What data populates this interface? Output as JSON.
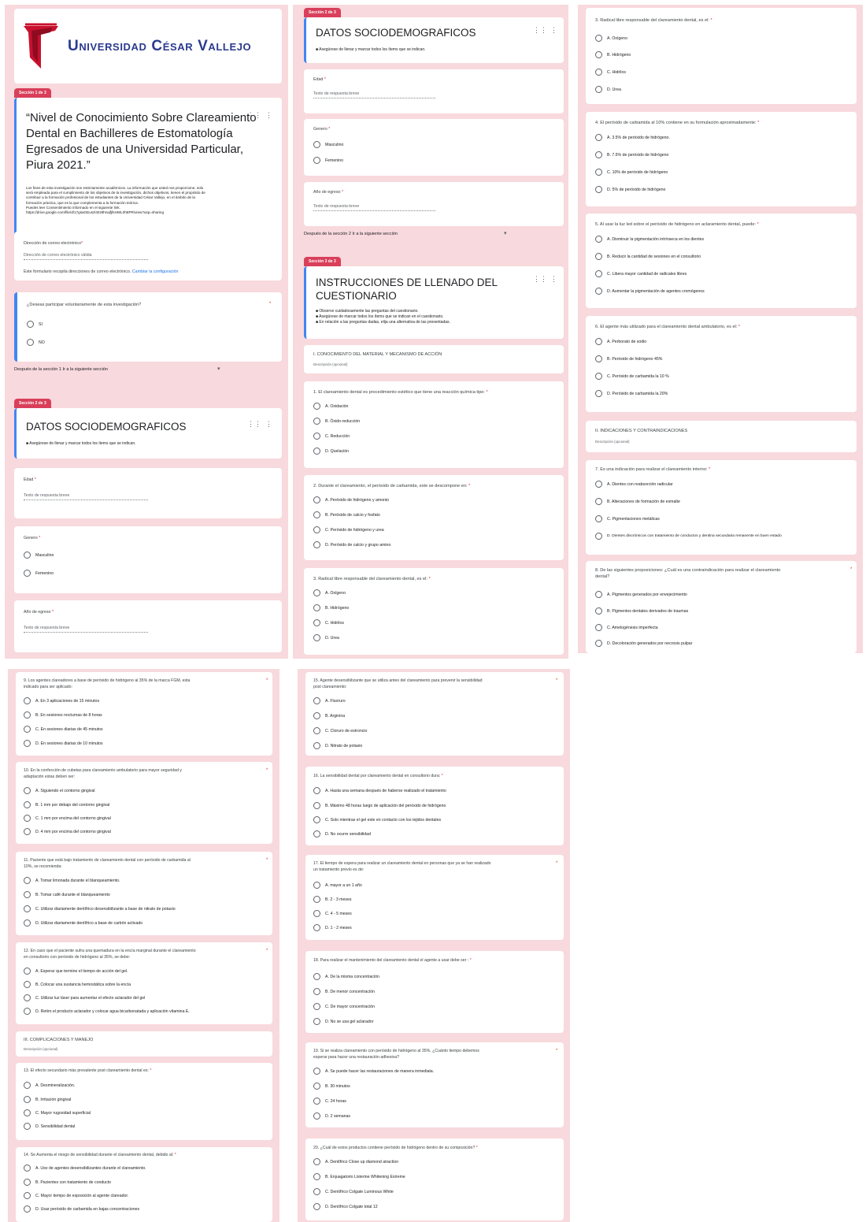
{
  "p1": {
    "logo_text": "Universidad César Vallejo",
    "tab1": "Sección 1 de 3",
    "title_lines": [
      "“Nivel de Conocimiento Sobre Clareamiento",
      "Dental en Bachilleres de Estomatología",
      "Egresados de una Universidad Particular,",
      "Piura 2021.”"
    ],
    "desc_lines": [
      "Los fines de esta investigación son estrictamente académicos. La información que usted nos proporcione, solo",
      "será empleada para el cumplimiento de los objetivos de la investigación, dichos objetivos, tienen el propósito de",
      "contribuir a la formación profesional de los estudiantes de la Universidad César Vallejo, en el ámbito de la",
      "formación práctica, que es la que complementa a la formación teórica.",
      "Puedes leer Consentimiento informado en el siguiente link.",
      "https://drive.google.com/file/d/17gsaGEuszl40z8hrwjfjfsHWL0h8PR/view?usp=sharing"
    ],
    "email_label": "Dirección de correo electrónico",
    "email_placeholder": "Dirección de correo electrónico válida",
    "email_note": "Este formulario recopila direcciones de correo electrónico.",
    "email_link": "Cambiar la configuración",
    "consent_q": "¿Deseas participar voluntariamente de esta investigación?",
    "consent_opts": [
      "SI",
      "NO"
    ],
    "after1": "Después de la sección 1     Ir a la siguiente sección",
    "tab2": "Sección 2 de 3",
    "sec2_title": "DATOS SOCIODEMOGRAFICOS",
    "sec2_bullet": "Asegúrese de llenar y marcar todos los ítems que se indican.",
    "age_label": "Edad",
    "short_answer": "Texto de respuesta breve",
    "gender_label": "Genero",
    "gender_opts": [
      "Masculino",
      "Femenino"
    ],
    "year_label": "Año de egreso"
  },
  "p2": {
    "tab2": "Sección 2 de 3",
    "sec2_title": "DATOS SOCIODEMOGRAFICOS",
    "sec2_bullet": "Asegúrese de llenar y marcar todos los ítems que se indican.",
    "age_label": "Edad",
    "short_answer": "Texto de respuesta breve",
    "gender_label": "Genero",
    "gender_opts": [
      "Masculino",
      "Femenino"
    ],
    "year_label": "Año de egreso",
    "after2": "Después de la sección 2     Ir a la siguiente sección",
    "tab3": "Sección 3 de 3",
    "sec3_title_lines": [
      "INSTRUCCIONES DE LLENADO DEL",
      "CUESTIONARIO"
    ],
    "sec3_bullets": [
      "Observe cuidadosamente las preguntas del cuestionario.",
      "Asegúrese de marcar todos los ítems que se indican en el cuestionario.",
      "En relación a las preguntas dadas, elija una alternativa de las presentadas."
    ],
    "part1_title": "I. CONOCIMIENTO DEL MATERIAL Y MECANISMO DE ACCIÓN",
    "part1_desc": "Descripción (opcional)",
    "q1": "1. El clareamiento dental es procedimiento estético que tiene una reacción química tipo:",
    "q1_opts": [
      "A. Oxidación",
      "B. Óxido-reducción",
      "C. Reducción",
      "D. Quelación"
    ],
    "q2": "2. Durante el clareamiento, el peróxido de carbamida, este se descompone en:",
    "q2_opts": [
      "A. Peróxido de hidrógeno y amonio",
      "B. Peróxido de calcio y fosfato",
      "C. Peróxido de hidrógeno y urea",
      "D. Peróxido de calcio y grupo amino"
    ],
    "q3": "3. Radical libre responsable del clareamiento dental, es el:",
    "q3_opts": [
      "A. Oxígeno",
      "B. Hidrógeno",
      "C. Hidrilos",
      "D. Urea"
    ]
  },
  "p3": {
    "q3": "3. Radical libre responsable del clareamiento dental, es el:",
    "q3_opts": [
      "A. Oxígeno",
      "B. Hidrógeno",
      "C. Hidrilos",
      "D. Urea"
    ],
    "q4": "4. El peróxido de carbamida al 10% contiene en su formulación aproximadamente:",
    "q4_opts": [
      "A. 3.5% de peróxido de hidrógeno.",
      "B. 7.5% de peróxido de hidrógeno",
      "C. 10% de peróxido de hidrógeno",
      "D. 5% de peróxido de hidrógeno"
    ],
    "q5": "5. Al usar la luz led sobre el peróxido de hidrógeno en aclaramiento dental, puede:",
    "q5_opts": [
      "A. Disminuir la pigmentación intrínseca en los dientes",
      "B. Reducir la cantidad de sesiones en el consultorio",
      "C. Libera mayor cantidad de radicales libres",
      "D. Aumentar la pigmentación de agentes cromógenos"
    ],
    "q6": "6. El agente más utilizado para el clareamiento dental ambulatorio, es el:",
    "q6_opts": [
      "A. Perborato de sodio",
      "B. Peróxido de hidrógeno 45%",
      "C. Peróxido de carbamida la 10 %",
      "D. Peróxido de carbamida la 20%"
    ],
    "part2_title": "II. INDICACIONES Y CONTRAINDICACIONES",
    "part2_desc": "Descripción (opcional)",
    "q7": "7. Es una indicación para realizar el clareamiento interno:",
    "q7_opts": [
      "A. Dientes con reabsorción radicular",
      "B. Alteraciones de formación de esmalte",
      "C. Pigmentaciones metálicas",
      "D. Dientes discrómicos con tratamiento de conductos y dentina secundaria remanente en buen estado"
    ],
    "q8_lines": [
      "8. De las siguientes proposiciones: ¿Cuál es una contraindicación para realizar el clareamiento",
      "dental?"
    ],
    "q8_opts": [
      "A. Pigmentos generados por envejecimiento",
      "B. Pigmentos dentales derivados de traumas",
      "C. Amelogénesis imperfecta",
      "D. Decoloración generados por necrosis pulpar"
    ]
  },
  "p4": {
    "q9_lines": [
      "9. Los agentes clareadores a base de peróxido de hidrógeno al 35% de la marca FGM, esta",
      "indicado para ser aplicado:"
    ],
    "q9_opts": [
      "A. En 3 aplicaciones de 15 minutos",
      "B. En sesiones nocturnas de 8 horas",
      "C. En sesiones diarias de 45 minutos",
      "D. En sesiones diarias de 10 minutos"
    ],
    "q10_lines": [
      "10. En la confección de cubetas para clareamiento ambulatorio  para mayor seguridad y",
      "adaptación estas deben ser:"
    ],
    "q10_opts": [
      "A. Siguiendo el contorno gingival",
      "B. 1 mm por debajo del contorno gingival",
      "C. 1 mm por encima del contorno gingival",
      "D. 4 mm por encima del contorno gingival"
    ],
    "q11_lines": [
      "11. Paciente que está bajo tratamiento de clareamiento dental con peróxido de carbamida al",
      "10%, se recomienda:"
    ],
    "q11_opts": [
      "A. Tomar limonada durante el blanqueamiento.",
      "B. Tomar café durante el blanqueamiento",
      "C. Utilizar diariamente dentífrico desensibilizante a base de nitrato de potasio",
      "D. Utilizar diariamente dentífrico a base de carbón activado"
    ],
    "q12_lines": [
      "12. En caso que el paciente sufra una quemadura en la encía marginal durante el clareamiento",
      "en consultorio con peróxido de hidrógeno al 35%, se debe:"
    ],
    "q12_opts": [
      "A. Esperar que termine el tiempo de acción del gel.",
      "B. Colocar una sustancia hemostática sobre la encía",
      "C. Utilizar luz láser para aumentar el efecto aclarador del gel",
      "D. Retiro el producto aclarador y colocar agua bicarbonatada y aplicación vitamina E."
    ],
    "part3_title": "III. COMPLICACIONES Y MANEJO",
    "part3_desc": "Descripción (opcional)",
    "q13": "13. El efecto secundario más prevalente post clareamiento dental es:",
    "q13_opts": [
      "A. Desmineralización.",
      "B. Irritación gingival",
      "C. Mayor rugosidad superficial",
      "D. Sensibilidad dental"
    ],
    "q14": "14. Se Aumenta el riesgo de sensibilidad durante el clareamiento dental, debido al:",
    "q14_opts": [
      "A. Uso  de agentes desensibilizantes durante el clareamiento.",
      "B. Pacientes con tratamiento de conducto",
      "C. Mayor tiempo de exposición al agente clareador.",
      "D. Usar peróxido de carbamida en bajas concentraciones"
    ]
  },
  "p5": {
    "q15_lines": [
      "15. Agente desensibilizante que se utiliza antes del clareamiento para prevenir la sensibilidad",
      "post clareamiento:"
    ],
    "q15_opts": [
      "A. Fluoruro",
      "B. Arginina",
      "C. Cloruro de estroncio",
      "D. Nitrato de potasio"
    ],
    "q16": "16. La sensibilidad dental por clareamiento dental en consultorio dura:",
    "q16_opts": [
      "A. Hasta una semana después de haberse realizado el tratamiento",
      "B. Máximo 48 horas luego de aplicación del peróxido de hidrógeno",
      "C. Solo mientras el gel este en contacto con los tejidos dentales",
      "D. No ocurre sensibilidad"
    ],
    "q17_lines": [
      "17. El tiempo de espera para realizar un clareamiento dental en personas que ya se han realizado",
      "un tratamiento previo es de:"
    ],
    "q17_opts": [
      "A. mayor a un 1 año",
      "B. 2 - 3 meses",
      "C. 4 - 5 meses",
      "D. 1 - 2 meses"
    ],
    "q18": "18. Para realizar el mantenimiento del clareamiento dental el agente a usar debe ser :",
    "q18_opts": [
      "A. De la misma concentración",
      "B. De menor concentración",
      "C. De mayor concentración",
      "D. No se usa gel aclarador"
    ],
    "q19_lines": [
      "19. Si se realiza clareamiento con peróxido de hidrógeno al 35%, ¿Cuánto tiempo debemos",
      "esperar para hacer una restauración adhesiva?"
    ],
    "q19_opts": [
      "A. Se puede hacer las restauraciones de manera inmediata.",
      "B. 30 minutos",
      "C. 24 horas",
      "D. 2 semanas"
    ],
    "q20": "20. ¿Cuál de estos productos contiene peróxido de hidrógeno dentro de su composición?",
    "q20_opts": [
      "A. Dentífrico Close up diamond atraction",
      "B. Enjuagatorio Listerine Whitening Extreme",
      "C. Dentífrico Colgate Luminous White",
      "D. Dentífrico Colgate total 12"
    ]
  },
  "colors": {
    "panel_bg": "#f8d9dd",
    "tab": "#d93f5a",
    "accent": "#4285f4",
    "required": "#d93025",
    "logo_red": "#c8102e",
    "logo_text": "#2b3a8f"
  },
  "icons": {
    "radio": "radio-button-icon",
    "drag": "drag-handle-icon",
    "menu": "more-vert-icon",
    "logo": "ucv-shield-logo-icon",
    "dropdown": "dropdown-caret-icon"
  }
}
